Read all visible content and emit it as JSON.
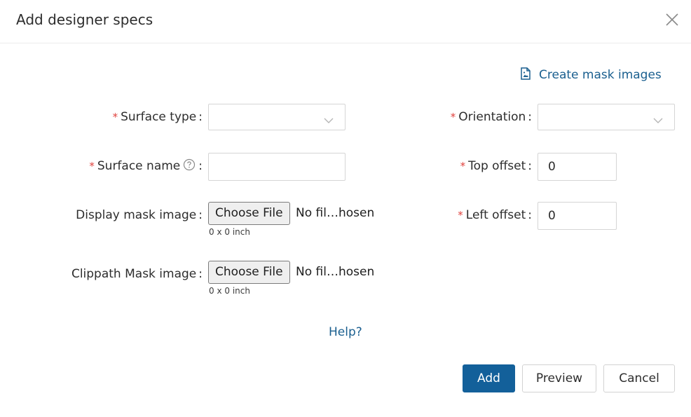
{
  "modal": {
    "title": "Add designer specs",
    "close_icon": "close-icon"
  },
  "actions": {
    "create_mask_label": "Create mask images",
    "create_mask_icon": "file-image-icon"
  },
  "form": {
    "surface_type": {
      "required": "*",
      "label": "Surface type",
      "colon": ":",
      "value": ""
    },
    "surface_name": {
      "required": "*",
      "label": "Surface name",
      "colon": ":",
      "value": "",
      "help_icon": "question-circle-icon"
    },
    "display_mask": {
      "label": "Display mask image",
      "colon": ":",
      "button": "Choose File",
      "file_text": "No fil…hosen",
      "size_note": "0 x 0 inch"
    },
    "clippath_mask": {
      "label": "Clippath Mask image",
      "colon": ":",
      "button": "Choose File",
      "file_text": "No fil…hosen",
      "size_note": "0 x 0 inch"
    },
    "orientation": {
      "required": "*",
      "label": "Orientation",
      "colon": ":",
      "value": ""
    },
    "top_offset": {
      "required": "*",
      "label": "Top offset",
      "colon": ":",
      "value": "0"
    },
    "left_offset": {
      "required": "*",
      "label": "Left offset",
      "colon": ":",
      "value": "0"
    }
  },
  "help_link": "Help?",
  "footer": {
    "add": "Add",
    "preview": "Preview",
    "cancel": "Cancel"
  },
  "colors": {
    "primary": "#13609a",
    "link": "#1a5f8f",
    "required": "#e0413d"
  }
}
